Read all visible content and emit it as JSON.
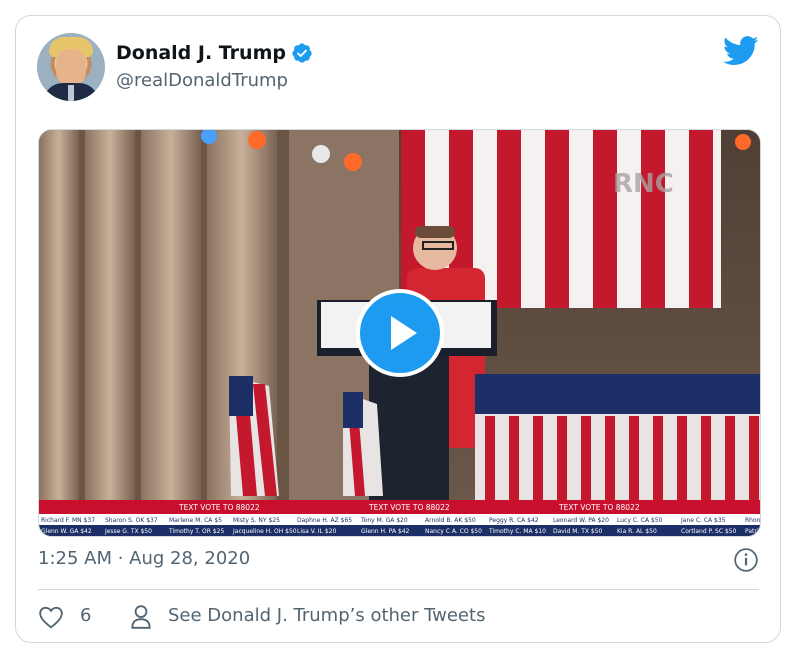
{
  "tweet": {
    "author_name": "Donald J. Trump",
    "author_handle": "@realDonaldTrump",
    "timestamp": "1:25 AM · Aug 28, 2020",
    "like_count": "6",
    "other_tweets_label": "See Donald J. Trump’s other Tweets"
  },
  "video": {
    "watermark": "RNC",
    "banner_text": [
      "TEXT VOTE TO 88022",
      "TEXT VOTE TO 88022",
      "TEXT VOTE TO 88022"
    ],
    "ticker_row1": [
      "Richard F. MN $37",
      "Sharon S. OK $37",
      "Marlene M. CA $5",
      "Misty S. NY $25",
      "Daphne H. AZ $65",
      "Tony M. GA $20",
      "Arnold B. AK $50",
      "Peggy R. CA $42",
      "Leonard W. PA $20",
      "Lucy C. CA $50",
      "Jane C. CA $35",
      "Rhonda J."
    ],
    "ticker_row2": [
      "Glenn W. GA $42",
      "Jesse G. TX $50",
      "Timothy T. OR $25",
      "Jacqueline H. OH $50",
      "Lisa V. IL $20",
      "Glenn H. PA $42",
      "Nancy C A. CO $50",
      "Timothy C. MA $10",
      "David M. TX $50",
      "Kia R. AL $50",
      "Cortland P. SC $50",
      "Patric"
    ]
  },
  "colors": {
    "verified_blue": "#1d9bf0",
    "twitter_blue": "#1d9bf0",
    "play_blue": "#1d9bf0",
    "banner_red": "#c8102e",
    "text_primary": "#0f1419",
    "text_secondary": "#536471"
  },
  "icons": {
    "verified": "verified-badge-icon",
    "brand": "twitter-bird-icon",
    "play": "play-icon",
    "info": "info-icon",
    "like": "heart-icon",
    "profile": "person-icon"
  }
}
